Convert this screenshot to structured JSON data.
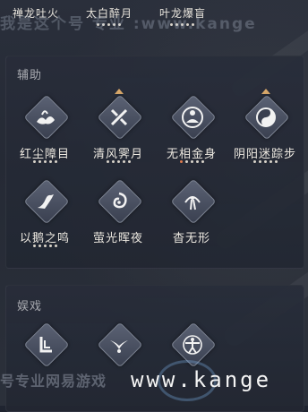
{
  "top_skills": [
    {
      "name": "禅龙吐火",
      "dots": 0
    },
    {
      "name": "太白醉月",
      "dots": 5,
      "active_dots": 0
    },
    {
      "name": "叶龙爆盲",
      "dots": 5,
      "active_dots": 0
    }
  ],
  "watermark": {
    "top": "我是这个号 专业 :www.kange",
    "bottom_left": "号专业网易游戏",
    "url": "www.kange"
  },
  "sections": {
    "assist": {
      "title": "辅助",
      "skills": [
        {
          "name": "红尘障目",
          "dots": 5,
          "active_dots": 0,
          "marker": false,
          "icon": "lotus-flame-icon"
        },
        {
          "name": "清风霁月",
          "dots": 5,
          "active_dots": 0,
          "marker": true,
          "icon": "crossed-blades-icon"
        },
        {
          "name": "无相金身",
          "dots": 5,
          "active_dots": 1,
          "marker": false,
          "icon": "meditating-monk-icon"
        },
        {
          "name": "阴阳迷踪步",
          "dots": 5,
          "active_dots": 0,
          "marker": true,
          "icon": "yin-yang-icon"
        },
        {
          "name": "以鹅之鸣",
          "dots": 5,
          "active_dots": 0,
          "marker": false,
          "icon": "goose-icon"
        },
        {
          "name": "萤光晖夜",
          "dots": 0,
          "active_dots": 0,
          "marker": false,
          "icon": "swirl-light-icon"
        },
        {
          "name": "杳无形",
          "dots": 0,
          "active_dots": 0,
          "marker": false,
          "icon": "vanishing-figure-icon"
        }
      ]
    },
    "entertain": {
      "title": "娱戏",
      "skills": [
        {
          "icon": "seated-figure-icon"
        },
        {
          "icon": "bird-figure-icon"
        },
        {
          "icon": "spread-arms-figure-icon"
        }
      ]
    }
  },
  "colors": {
    "dot_active": "#e07b4e",
    "dot_inactive": "#d9d4ca",
    "marker": "#d9a86a"
  }
}
